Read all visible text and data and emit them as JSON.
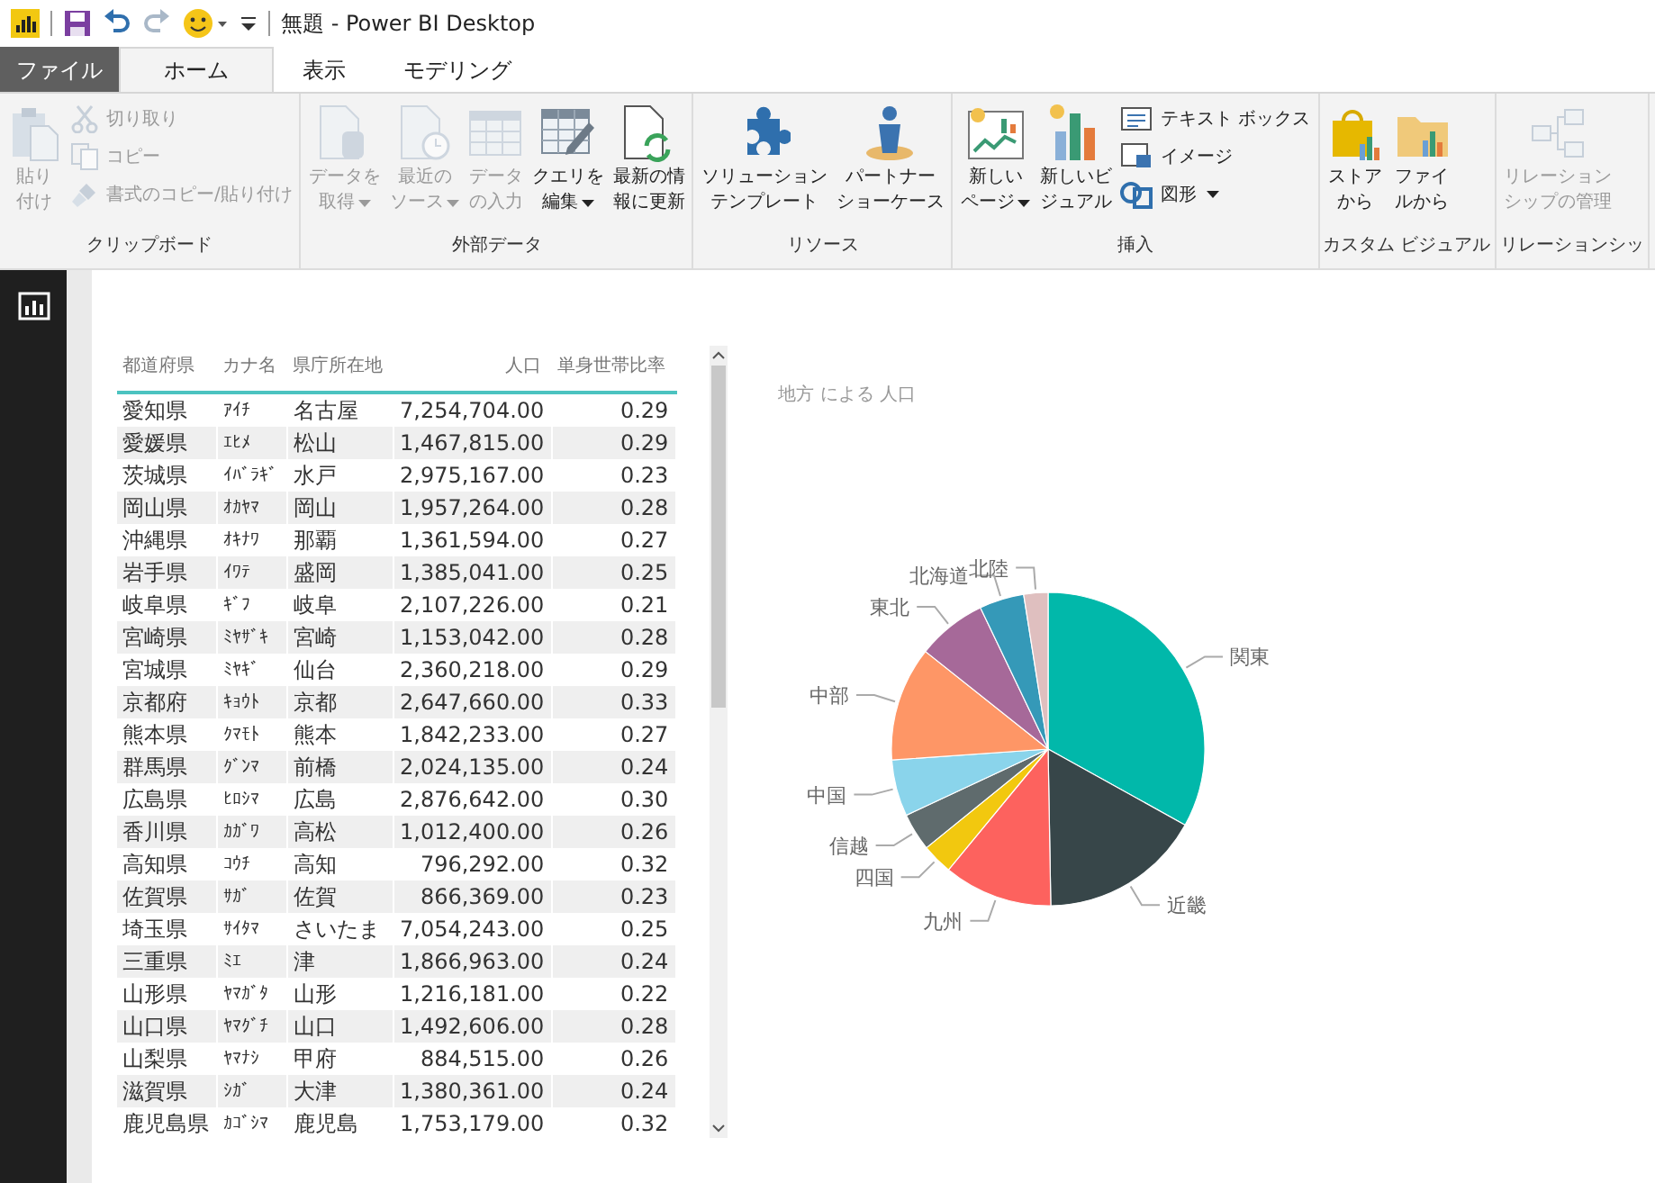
{
  "window": {
    "title": "無題 - Power BI Desktop"
  },
  "tabs": [
    {
      "label": "ファイル",
      "kind": "file",
      "selected": false
    },
    {
      "label": "ホーム",
      "kind": "tab",
      "selected": true
    },
    {
      "label": "表示",
      "kind": "tab",
      "selected": false
    },
    {
      "label": "モデリング",
      "kind": "tab",
      "selected": false
    }
  ],
  "ribbon_groups": [
    {
      "title": "クリップボード",
      "buttons": [
        {
          "lines": [
            "貼り",
            "付け"
          ],
          "kind": "large",
          "disabled": true
        },
        {
          "lines": [
            "切り取り"
          ],
          "kind": "small",
          "disabled": true
        },
        {
          "lines": [
            "コピー"
          ],
          "kind": "small",
          "disabled": true
        },
        {
          "lines": [
            "書式のコピー/貼り付け"
          ],
          "kind": "small",
          "disabled": true
        }
      ]
    },
    {
      "title": "外部データ",
      "buttons": [
        {
          "lines": [
            "データを",
            "取得"
          ],
          "kind": "large",
          "dropdown": true,
          "disabled": true
        },
        {
          "lines": [
            "最近の",
            "ソース"
          ],
          "kind": "large",
          "dropdown": true,
          "disabled": true
        },
        {
          "lines": [
            "データ",
            "の入力"
          ],
          "kind": "large",
          "disabled": true
        },
        {
          "lines": [
            "クエリを",
            "編集"
          ],
          "kind": "large",
          "dropdown": true,
          "disabled": false
        },
        {
          "lines": [
            "最新の情",
            "報に更新"
          ],
          "kind": "large",
          "disabled": false
        }
      ]
    },
    {
      "title": "リソース",
      "buttons": [
        {
          "lines": [
            "ソリューション",
            "テンプレート"
          ],
          "kind": "large",
          "disabled": false
        },
        {
          "lines": [
            "パートナー",
            "ショーケース"
          ],
          "kind": "large",
          "disabled": false
        }
      ]
    },
    {
      "title": "挿入",
      "buttons": [
        {
          "lines": [
            "新しい",
            "ページ"
          ],
          "kind": "large",
          "dropdown": true,
          "disabled": false
        },
        {
          "lines": [
            "新しいビ",
            "ジュアル"
          ],
          "kind": "large",
          "disabled": false
        },
        {
          "lines": [
            "テキスト ボックス"
          ],
          "kind": "small",
          "disabled": false
        },
        {
          "lines": [
            "イメージ"
          ],
          "kind": "small",
          "disabled": false
        },
        {
          "lines": [
            "図形"
          ],
          "kind": "small",
          "dropdown": true,
          "disabled": false
        }
      ]
    },
    {
      "title": "カスタム ビジュアル",
      "buttons": [
        {
          "lines": [
            "ストア",
            "から"
          ],
          "kind": "large",
          "disabled": false
        },
        {
          "lines": [
            "ファイ",
            "ルから"
          ],
          "kind": "large",
          "disabled": false
        }
      ]
    },
    {
      "title": "リレーションシッ",
      "buttons": [
        {
          "lines": [
            "リレーション",
            "シップの管理"
          ],
          "kind": "large",
          "disabled": true
        }
      ]
    }
  ],
  "table": {
    "columns": [
      "都道府県",
      "カナ名",
      "県庁所在地",
      "人口",
      "単身世帯比率"
    ],
    "rows": [
      [
        "愛知県",
        "ｱｲﾁ",
        "名古屋",
        "7,254,704.00",
        "0.29"
      ],
      [
        "愛媛県",
        "ｴﾋﾒ",
        "松山",
        "1,467,815.00",
        "0.29"
      ],
      [
        "茨城県",
        "ｲﾊﾞﾗｷﾞ",
        "水戸",
        "2,975,167.00",
        "0.23"
      ],
      [
        "岡山県",
        "ｵｶﾔﾏ",
        "岡山",
        "1,957,264.00",
        "0.28"
      ],
      [
        "沖縄県",
        "ｵｷﾅﾜ",
        "那覇",
        "1,361,594.00",
        "0.27"
      ],
      [
        "岩手県",
        "ｲﾜﾃ",
        "盛岡",
        "1,385,041.00",
        "0.25"
      ],
      [
        "岐阜県",
        "ｷﾞﾌ",
        "岐阜",
        "2,107,226.00",
        "0.21"
      ],
      [
        "宮崎県",
        "ﾐﾔｻﾞｷ",
        "宮崎",
        "1,153,042.00",
        "0.28"
      ],
      [
        "宮城県",
        "ﾐﾔｷﾞ",
        "仙台",
        "2,360,218.00",
        "0.29"
      ],
      [
        "京都府",
        "ｷｮｳﾄ",
        "京都",
        "2,647,660.00",
        "0.33"
      ],
      [
        "熊本県",
        "ｸﾏﾓﾄ",
        "熊本",
        "1,842,233.00",
        "0.27"
      ],
      [
        "群馬県",
        "ｸﾞﾝﾏ",
        "前橋",
        "2,024,135.00",
        "0.24"
      ],
      [
        "広島県",
        "ﾋﾛｼﾏ",
        "広島",
        "2,876,642.00",
        "0.30"
      ],
      [
        "香川県",
        "ｶｶﾞﾜ",
        "高松",
        "1,012,400.00",
        "0.26"
      ],
      [
        "高知県",
        "ｺｳﾁ",
        "高知",
        "796,292.00",
        "0.32"
      ],
      [
        "佐賀県",
        "ｻｶﾞ",
        "佐賀",
        "866,369.00",
        "0.23"
      ],
      [
        "埼玉県",
        "ｻｲﾀﾏ",
        "さいたま",
        "7,054,243.00",
        "0.25"
      ],
      [
        "三重県",
        "ﾐｴ",
        "津",
        "1,866,963.00",
        "0.24"
      ],
      [
        "山形県",
        "ﾔﾏｶﾞﾀ",
        "山形",
        "1,216,181.00",
        "0.22"
      ],
      [
        "山口県",
        "ﾔﾏｸﾞﾁ",
        "山口",
        "1,492,606.00",
        "0.28"
      ],
      [
        "山梨県",
        "ﾔﾏﾅｼ",
        "甲府",
        "884,515.00",
        "0.26"
      ],
      [
        "滋賀県",
        "ｼｶﾞ",
        "大津",
        "1,380,361.00",
        "0.24"
      ],
      [
        "鹿児島県",
        "ｶｺﾞｼﾏ",
        "鹿児島",
        "1,753,179.00",
        "0.32"
      ]
    ]
  },
  "pie": {
    "title": "地方 による 人口",
    "slices": [
      {
        "label": "関東",
        "color": "#01b8aa"
      },
      {
        "label": "近畿",
        "color": "#374649"
      },
      {
        "label": "九州",
        "color": "#fd625e"
      },
      {
        "label": "四国",
        "color": "#f2c80f"
      },
      {
        "label": "信越",
        "color": "#5f6b6d"
      },
      {
        "label": "中国",
        "color": "#8ad4eb"
      },
      {
        "label": "中部",
        "color": "#fe9666"
      },
      {
        "label": "東北",
        "color": "#a66999"
      },
      {
        "label": "北海道",
        "color": "#3599b8"
      },
      {
        "label": "北陸",
        "color": "#dfbfbf"
      }
    ]
  }
}
